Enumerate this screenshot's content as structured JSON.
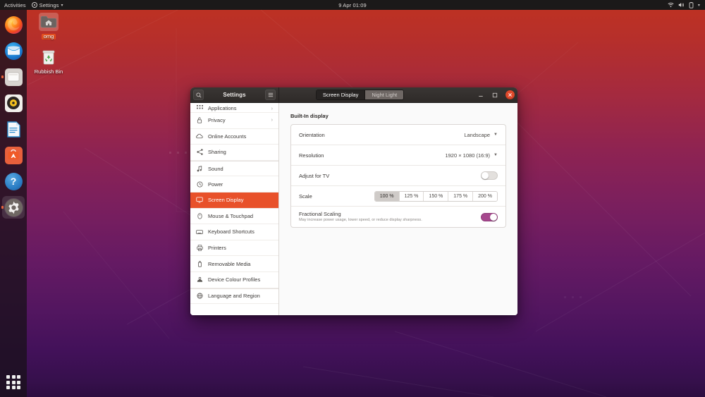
{
  "top_panel": {
    "activities": "Activities",
    "app_name": "Settings",
    "clock": "9 Apr 01:09",
    "status_icons": [
      "wifi-icon",
      "volume-icon",
      "battery-icon",
      "dropdown-arrow-icon"
    ]
  },
  "dock": {
    "items": [
      {
        "name": "firefox",
        "label": "Firefox",
        "running": false
      },
      {
        "name": "thunderbird",
        "label": "Thunderbird",
        "running": false
      },
      {
        "name": "files",
        "label": "Files",
        "running": true
      },
      {
        "name": "rhythmbox",
        "label": "Rhythmbox",
        "running": false
      },
      {
        "name": "libreoffice-writer",
        "label": "LibreOffice Writer",
        "running": false
      },
      {
        "name": "ubuntu-software",
        "label": "Ubuntu Software",
        "running": false
      },
      {
        "name": "help",
        "label": "Help",
        "running": false
      },
      {
        "name": "settings",
        "label": "Settings",
        "running": true,
        "active": true
      }
    ],
    "app_grid_label": "Show Applications"
  },
  "desktop_icons": [
    {
      "name": "home-folder",
      "label": "omg",
      "selected": true
    },
    {
      "name": "trash",
      "label": "Rubbish Bin",
      "selected": false
    }
  ],
  "window": {
    "title": "Settings",
    "search_icon": "search-icon",
    "menu_icon": "hamburger-menu-icon",
    "view_tabs": [
      {
        "label": "Screen Display",
        "active": true
      },
      {
        "label": "Night Light",
        "active": false
      }
    ],
    "controls": {
      "minimize": "minimize-icon",
      "maximize": "maximize-icon",
      "close": "close-icon"
    }
  },
  "sidebar": {
    "items": [
      {
        "label": "Applications",
        "icon": "grid-icon",
        "chevron": "›",
        "selected": false,
        "partial": true
      },
      {
        "label": "Privacy",
        "icon": "lock-icon",
        "chevron": "›",
        "selected": false
      },
      {
        "label": "Online Accounts",
        "icon": "cloud-icon",
        "chevron": "",
        "selected": false
      },
      {
        "label": "Sharing",
        "icon": "share-icon",
        "chevron": "",
        "selected": false
      },
      {
        "label": "Sound",
        "icon": "music-note-icon",
        "chevron": "",
        "selected": false,
        "group_start": true
      },
      {
        "label": "Power",
        "icon": "power-icon",
        "chevron": "",
        "selected": false
      },
      {
        "label": "Screen Display",
        "icon": "monitor-icon",
        "chevron": "",
        "selected": true
      },
      {
        "label": "Mouse & Touchpad",
        "icon": "mouse-icon",
        "chevron": "",
        "selected": false
      },
      {
        "label": "Keyboard Shortcuts",
        "icon": "keyboard-icon",
        "chevron": "",
        "selected": false
      },
      {
        "label": "Printers",
        "icon": "printer-icon",
        "chevron": "",
        "selected": false
      },
      {
        "label": "Removable Media",
        "icon": "usb-drive-icon",
        "chevron": "",
        "selected": false
      },
      {
        "label": "Device Colour Profiles",
        "icon": "color-profile-icon",
        "chevron": "",
        "selected": false
      },
      {
        "label": "Language and Region",
        "icon": "globe-icon",
        "chevron": "",
        "selected": false,
        "group_start": true
      }
    ]
  },
  "content": {
    "section_title": "Built-In display",
    "orientation": {
      "label": "Orientation",
      "value": "Landscape"
    },
    "resolution": {
      "label": "Resolution",
      "value": "1920 × 1080 (16:9)"
    },
    "adjust_for_tv": {
      "label": "Adjust for TV",
      "on": false
    },
    "scale": {
      "label": "Scale",
      "options": [
        "100 %",
        "125 %",
        "150 %",
        "175 %",
        "200 %"
      ],
      "selected": "100 %"
    },
    "fractional_scaling": {
      "label": "Fractional Scaling",
      "subtitle": "May increase power usage, lower speed, or reduce display sharpness.",
      "on": true
    }
  },
  "colors": {
    "accent": "#e8512a",
    "toggle_on": "#a6488e",
    "titlebar": "#332f2d",
    "close_button": "#e0492b"
  }
}
